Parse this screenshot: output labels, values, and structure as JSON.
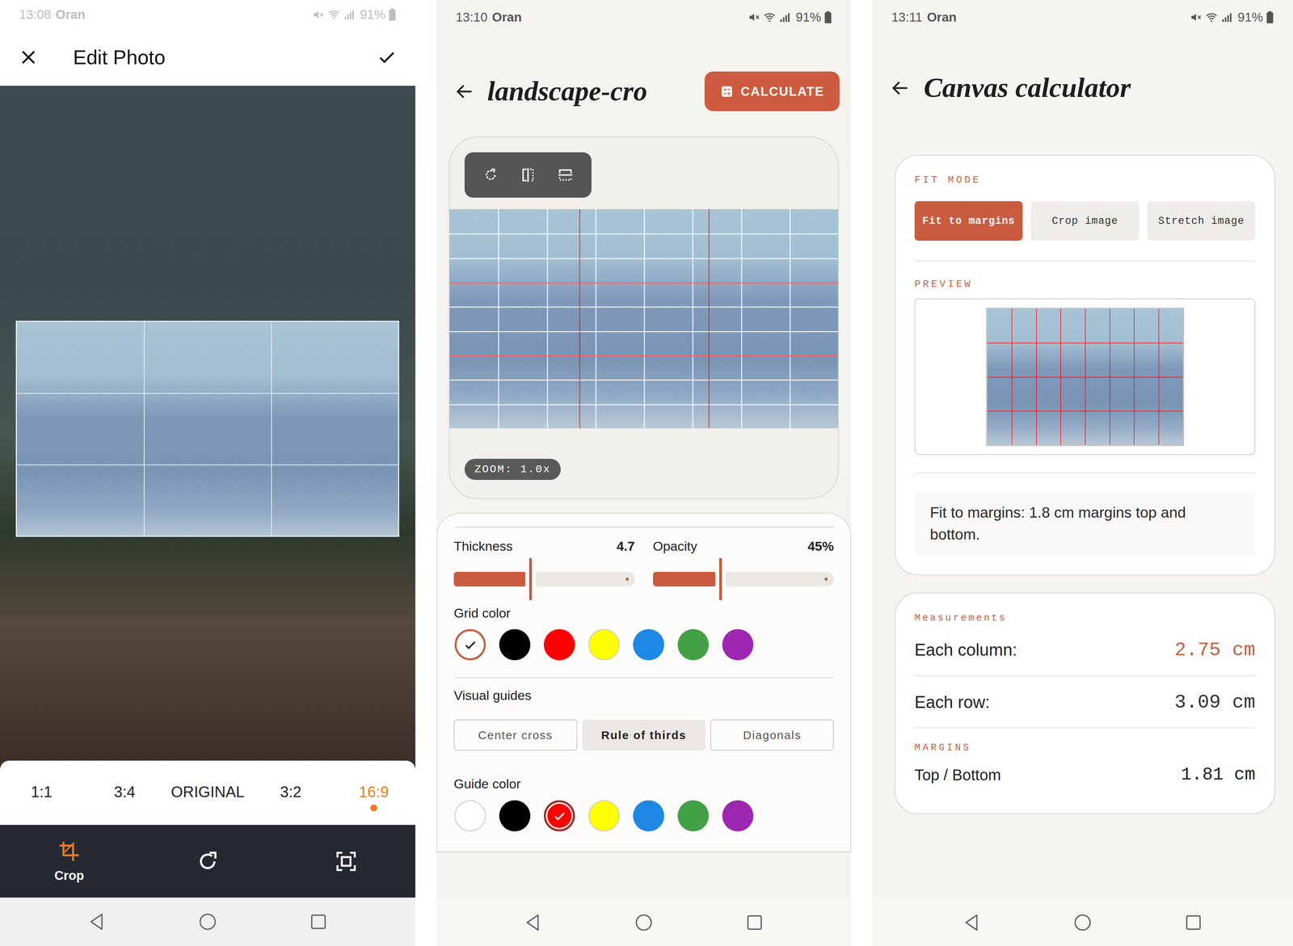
{
  "edit_photo": {
    "status_bar": {
      "time": "13:08",
      "carrier": "Oran",
      "battery": "91%"
    },
    "title": "Edit Photo",
    "aspect_ratios": [
      {
        "label": "1:1",
        "selected": false
      },
      {
        "label": "3:4",
        "selected": false
      },
      {
        "label": "ORIGINAL",
        "selected": false
      },
      {
        "label": "3:2",
        "selected": false
      },
      {
        "label": "16:9",
        "selected": true
      }
    ],
    "tools": [
      {
        "kind": "crop",
        "label": "Crop",
        "selected": true
      },
      {
        "kind": "rotate",
        "selected": false
      },
      {
        "kind": "fit",
        "selected": false
      }
    ]
  },
  "grid_editor": {
    "status_bar": {
      "time": "13:10",
      "carrier": "Oran",
      "battery": "91%"
    },
    "title": "landscape-cro",
    "calculate_button": "CALCULATE",
    "zoom": "ZOOM: 1.0x",
    "sliders": [
      {
        "label": "Thickness",
        "reading": "4.7",
        "level": 0.42
      },
      {
        "label": "Opacity",
        "reading": "45%",
        "level": 0.37
      }
    ],
    "grid_color": {
      "label": "Grid color",
      "swatches": [
        {
          "color": "#ffffff",
          "selected": true
        },
        {
          "color": "#000000",
          "selected": false
        },
        {
          "color": "#ff0000",
          "selected": false
        },
        {
          "color": "#ffff00",
          "selected": false
        },
        {
          "color": "#1e88e5",
          "selected": false
        },
        {
          "color": "#43a047",
          "selected": false
        },
        {
          "color": "#9c27b0",
          "selected": false
        }
      ]
    },
    "visual_guides": {
      "label": "Visual guides",
      "options": [
        {
          "label": "Center cross",
          "selected": false
        },
        {
          "label": "Rule of thirds",
          "selected": true
        },
        {
          "label": "Diagonals",
          "selected": false
        }
      ]
    },
    "guide_color": {
      "label": "Guide color",
      "swatches": [
        {
          "color": "#ffffff",
          "selected": false
        },
        {
          "color": "#000000",
          "selected": false
        },
        {
          "color": "#ff0000",
          "selected": true
        },
        {
          "color": "#ffff00",
          "selected": false
        },
        {
          "color": "#1e88e5",
          "selected": false
        },
        {
          "color": "#43a047",
          "selected": false
        },
        {
          "color": "#9c27b0",
          "selected": false
        }
      ]
    }
  },
  "canvas_calculator": {
    "status_bar": {
      "time": "13:11",
      "carrier": "Oran",
      "battery": "91%"
    },
    "title": "Canvas calculator",
    "fit_mode": {
      "label": "FIT MODE",
      "options": [
        {
          "label": "Fit to margins",
          "selected": true
        },
        {
          "label": "Crop image",
          "selected": false
        },
        {
          "label": "Stretch image",
          "selected": false
        }
      ]
    },
    "preview_label": "PREVIEW",
    "note": "Fit to margins: 1.8 cm margins top and bottom.",
    "measurements": {
      "label": "Measurements",
      "rows": [
        {
          "label": "Each column:",
          "value": "2.75 cm",
          "highlighted": true
        },
        {
          "label": "Each row:",
          "value": "3.09 cm",
          "highlighted": false
        }
      ],
      "margins_label": "MARGINS",
      "margins": [
        {
          "label": "Top / Bottom",
          "value": "1.81 cm"
        }
      ]
    }
  }
}
